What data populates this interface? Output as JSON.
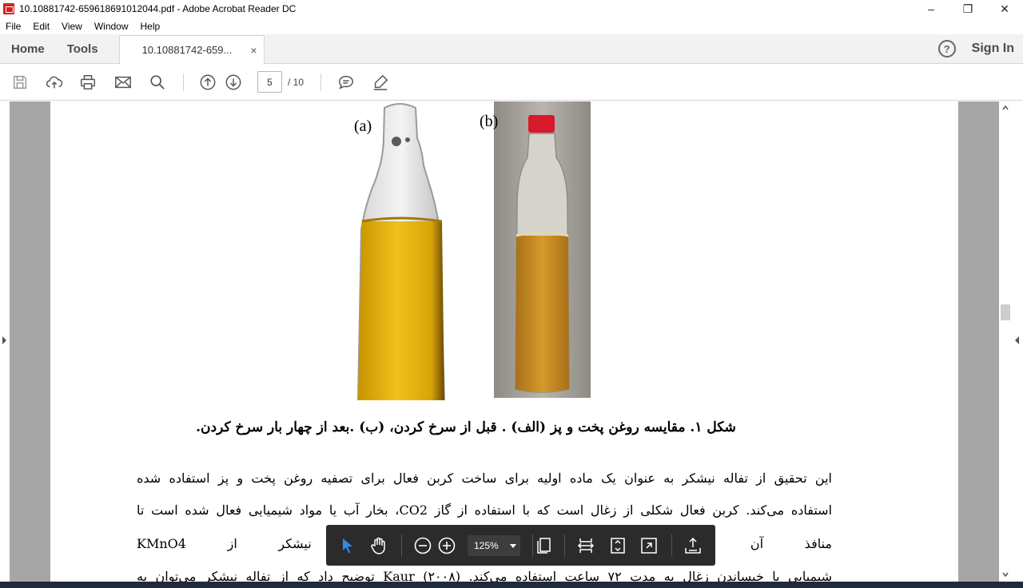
{
  "window": {
    "title": "10.10881742-659618691012044.pdf - Adobe Acrobat Reader DC",
    "minimize": "–",
    "maximize": "❐",
    "close": "✕"
  },
  "menu": [
    "File",
    "Edit",
    "View",
    "Window",
    "Help"
  ],
  "tabs": {
    "home": "Home",
    "tools": "Tools",
    "doc": "10.10881742-659...",
    "doc_close": "×",
    "help": "?",
    "signin": "Sign In"
  },
  "toolbar": {
    "page_current": "5",
    "page_total": "/ 10"
  },
  "document": {
    "label_a": "(a)",
    "label_b": "(b)",
    "caption": "شکل ۱. مقایسه روغن پخت و پز (الف) . قبل از سرخ کردن، (ب) .بعد از چهار بار سرخ کردن.",
    "lines": [
      "این تحقیق از تفاله نیشکر به عنوان یک ماده اولیه برای ساخت کربن فعال برای تصفیه روغن پخت و پز استفاده شده",
      "استفاده می‌کند. کربن فعال شکلی از زغال است که با استفاده از گاز CO2، بخار آب یا مواد شیمیایی فعال شده است تا",
      "منافذ آن باز شود و د                                                                              ن زغال تفاله نیشکر از KMnO4",
      "شیمیایی با خیساندن زغال به مدت ۷۲ ساعت استفاده می‌کند. Kaur (۲۰۰۸) توضیح داد که از تفاله نیشکر می‌توان به"
    ]
  },
  "floating_toolbar": {
    "zoom": "125%"
  },
  "colors": {
    "oil_a": "#e3b10c",
    "oil_b": "#c98a1e",
    "cap_b": "#d8192a",
    "floatbar": "#2b2b2b",
    "select_tool": "#2f8ae5"
  }
}
